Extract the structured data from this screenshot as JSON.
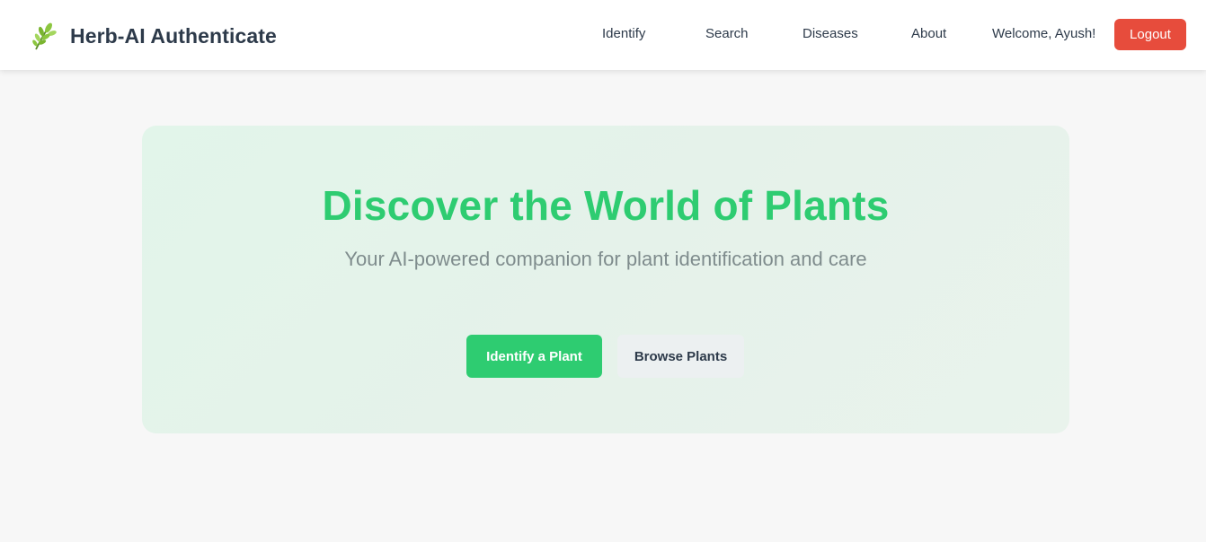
{
  "navbar": {
    "brand_name": "Herb-AI Authenticate",
    "brand_icon": "leaf-sprig-icon",
    "links": {
      "identify": "Identify",
      "search": "Search",
      "diseases": "Diseases",
      "about": "About"
    },
    "welcome_text": "Welcome, Ayush!",
    "logout_label": "Logout"
  },
  "hero": {
    "title": "Discover the World of Plants",
    "subtitle": "Your AI-powered companion for plant identification and care",
    "primary_button": "Identify a Plant",
    "secondary_button": "Browse Plants"
  },
  "colors": {
    "accent": "#2ecc71",
    "danger": "#e74c3c",
    "text": "#2d3a4a",
    "muted": "#7f8c8d",
    "hero_bg": "#e3f4ea"
  }
}
